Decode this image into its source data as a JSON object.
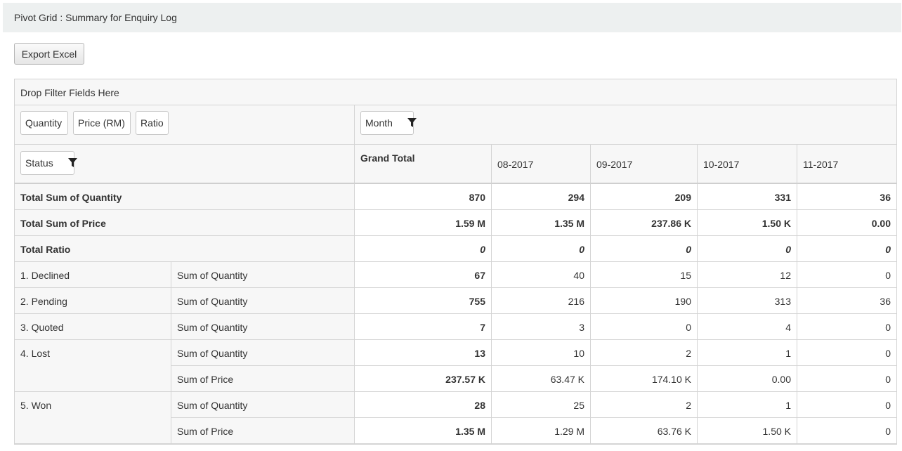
{
  "panel": {
    "title": "Pivot Grid : Summary for Enquiry Log"
  },
  "toolbar": {
    "export_label": "Export Excel"
  },
  "pivot": {
    "filter_area_label": "Drop Filter Fields Here",
    "data_fields": [
      "Quantity",
      "Price (RM)",
      "Ratio"
    ],
    "column_field": "Month",
    "row_field": "Status",
    "grand_total_label": "Grand Total",
    "months": [
      "08-2017",
      "09-2017",
      "10-2017",
      "11-2017"
    ],
    "totals": [
      {
        "label": "Total Sum of Quantity",
        "grand": "870",
        "values": [
          "294",
          "209",
          "331",
          "36"
        ]
      },
      {
        "label": "Total Sum of Price",
        "grand": "1.59 M",
        "values": [
          "1.35 M",
          "237.86 K",
          "1.50 K",
          "0.00"
        ]
      },
      {
        "label": "Total Ratio",
        "grand": "0",
        "values": [
          "0",
          "0",
          "0",
          "0"
        ]
      }
    ],
    "rows": [
      {
        "status": "1. Declined",
        "measure": "Sum of Quantity",
        "grand": "67",
        "values": [
          "40",
          "15",
          "12",
          "0"
        ]
      },
      {
        "status": "2. Pending",
        "measure": "Sum of Quantity",
        "grand": "755",
        "values": [
          "216",
          "190",
          "313",
          "36"
        ]
      },
      {
        "status": "3. Quoted",
        "measure": "Sum of Quantity",
        "grand": "7",
        "values": [
          "3",
          "0",
          "4",
          "0"
        ]
      },
      {
        "status": "4. Lost",
        "measure": "Sum of Quantity",
        "grand": "13",
        "values": [
          "10",
          "2",
          "1",
          "0"
        ]
      },
      {
        "status": "",
        "measure": "Sum of Price",
        "grand": "237.57 K",
        "values": [
          "63.47 K",
          "174.10 K",
          "0.00",
          "0"
        ]
      },
      {
        "status": "5. Won",
        "measure": "Sum of Quantity",
        "grand": "28",
        "values": [
          "25",
          "2",
          "1",
          "0"
        ]
      },
      {
        "status": "",
        "measure": "Sum of Price",
        "grand": "1.35 M",
        "values": [
          "1.29 M",
          "63.76 K",
          "1.50 K",
          "0"
        ]
      }
    ]
  },
  "icons": {
    "filter": "funnel-icon"
  },
  "colors": {
    "header_bg": "#edf0f0",
    "border": "#d4d4d4",
    "area_bg": "#f7f7f7"
  }
}
